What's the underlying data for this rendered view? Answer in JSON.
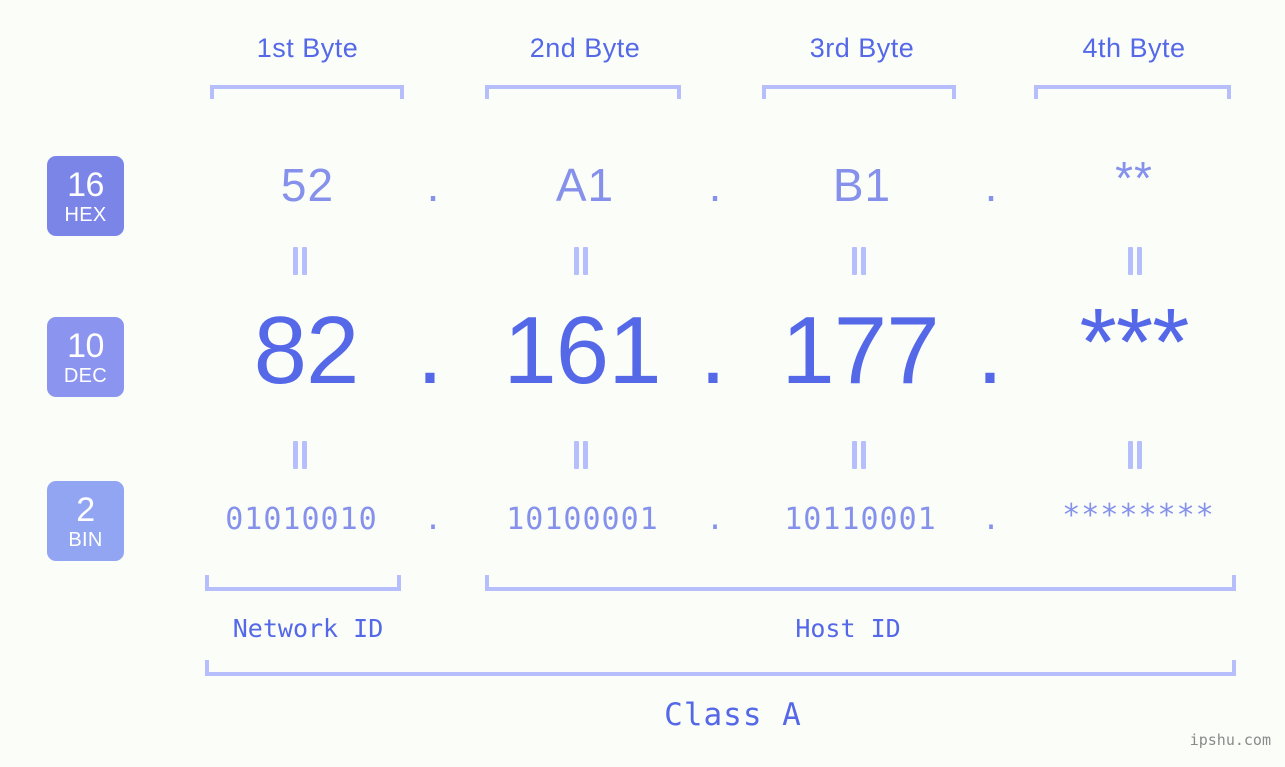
{
  "page": {
    "background": "#fbfdf9",
    "watermark": "ipshu.com"
  },
  "palette": {
    "dec_strong": "#5468e8",
    "hex_light": "#8591ea",
    "bracket": "#b6bffb",
    "badge_hex": "#7b85e8",
    "badge_dec": "#8b95ef",
    "badge_bin": "#92a5f3",
    "watermark_gray": "#8a8a8a"
  },
  "headers": [
    {
      "label": "1st Byte"
    },
    {
      "label": "2nd Byte"
    },
    {
      "label": "3rd Byte"
    },
    {
      "label": "4th Byte"
    }
  ],
  "bases": [
    {
      "num": "16",
      "abbr": "HEX"
    },
    {
      "num": "10",
      "abbr": "DEC"
    },
    {
      "num": "2",
      "abbr": "BIN"
    }
  ],
  "rows": {
    "hex": {
      "values": [
        "52",
        "A1",
        "B1",
        "**"
      ],
      "separators": [
        ".",
        ".",
        "."
      ]
    },
    "dec": {
      "values": [
        "82",
        "161",
        "177",
        "***"
      ],
      "separators": [
        ".",
        ".",
        "."
      ]
    },
    "bin": {
      "values": [
        "01010010",
        "10100001",
        "10110001",
        "********"
      ],
      "separators": [
        ".",
        ".",
        "."
      ]
    }
  },
  "equals_glyph": "=",
  "segments": {
    "network_id": "Network ID",
    "host_id": "Host ID"
  },
  "class": {
    "label": "Class A"
  }
}
